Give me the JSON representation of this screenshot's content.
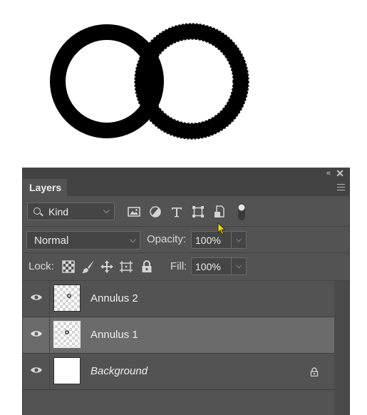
{
  "canvas": {
    "shapes": [
      "solid-ring",
      "rough-ring-selected"
    ]
  },
  "panel": {
    "collapse_label": "«",
    "close_label": "✕",
    "tab_label": "Layers",
    "menu_icon": "hamburger-icon"
  },
  "filter": {
    "kind_label": "Kind",
    "kind_icon": "search-icon",
    "filter_icons": [
      "image-filter-icon",
      "adjustment-filter-icon",
      "type-filter-icon",
      "shape-filter-icon",
      "smart-object-filter-icon",
      "filter-toggle-icon"
    ]
  },
  "blend": {
    "mode": "Normal",
    "opacity_label": "Opacity:",
    "opacity_value": "100%"
  },
  "lock": {
    "label": "Lock:",
    "icons": [
      "lock-transparent-pixels-icon",
      "lock-image-pixels-icon",
      "lock-position-icon",
      "lock-artboard-icon",
      "lock-all-icon"
    ],
    "fill_label": "Fill:",
    "fill_value": "100%"
  },
  "layers": [
    {
      "name": "Annulus 2",
      "visible": true,
      "selected": false,
      "thumbnail": "transparent",
      "locked": false
    },
    {
      "name": "Annulus 1",
      "visible": true,
      "selected": true,
      "thumbnail": "transparent",
      "locked": false
    },
    {
      "name": "Background",
      "visible": true,
      "selected": false,
      "thumbnail": "white",
      "locked": true
    }
  ],
  "colors": {
    "panel_bg": "#535353",
    "selected_row": "#6b6b6b",
    "cursor": "#f5d60a"
  }
}
